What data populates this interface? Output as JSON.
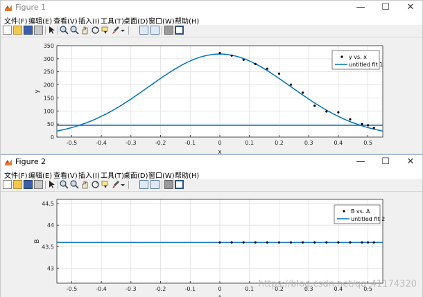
{
  "colors": {
    "fit_line": "#0072bd",
    "hline": "#0072bd",
    "points": "#000000",
    "grid": "#dfdfdf"
  },
  "figure1": {
    "title": "Figure 1",
    "menu": [
      "文件(F)",
      "编辑(E)",
      "查看(V)",
      "插入(I)",
      "工具(T)",
      "桌面(D)",
      "窗口(W)",
      "帮助(H)"
    ],
    "toolbar_icons": [
      "new-file-icon",
      "open-folder-icon",
      "save-icon",
      "print-icon",
      "pointer-icon",
      "zoom-in-icon",
      "zoom-out-icon",
      "pan-hand-icon",
      "rotate-3d-icon",
      "data-cursor-icon",
      "brush-icon",
      "brush-dropdown-icon",
      "colorbar-icon",
      "legend-icon",
      "plot-tools-hide-icon",
      "plot-tools-show-icon"
    ],
    "window_controls": {
      "minimize": "—",
      "maximize": "☐",
      "close": "✕"
    },
    "chart_data": {
      "type": "scatter",
      "xlabel": "x",
      "ylabel": "y",
      "xlim": [
        -0.55,
        0.55
      ],
      "ylim": [
        0,
        350
      ],
      "xticks": [
        "-0.5",
        "-0.4",
        "-0.3",
        "-0.2",
        "-0.1",
        "0",
        "0.1",
        "0.2",
        "0.3",
        "0.4",
        "0.5"
      ],
      "xtick_values": [
        -0.5,
        -0.4,
        -0.3,
        -0.2,
        -0.1,
        0,
        0.1,
        0.2,
        0.3,
        0.4,
        0.5
      ],
      "yticks": [
        "0",
        "50",
        "100",
        "150",
        "200",
        "250",
        "300",
        "350"
      ],
      "ytick_values": [
        0,
        50,
        100,
        150,
        200,
        250,
        300,
        350
      ],
      "grid": true,
      "legend_position": "top-right",
      "series": [
        {
          "name": "y vs. x",
          "kind": "points",
          "x": [
            0,
            0.04,
            0.08,
            0.12,
            0.16,
            0.2,
            0.24,
            0.28,
            0.32,
            0.36,
            0.4,
            0.44,
            0.48,
            0.5,
            0.52
          ],
          "y": [
            322,
            312,
            296,
            280,
            262,
            243,
            201,
            170,
            120,
            98,
            95,
            68,
            50,
            45,
            35
          ]
        },
        {
          "name": "untitled fit 1",
          "kind": "gaussian-curve",
          "amplitude": 318,
          "mean": 0,
          "sigma": 0.24
        }
      ],
      "hline": 45
    }
  },
  "figure2": {
    "title": "Figure 2",
    "menu": [
      "文件(F)",
      "编辑(E)",
      "查看(V)",
      "插入(I)",
      "工具(T)",
      "桌面(D)",
      "窗口(W)",
      "帮助(H)"
    ],
    "toolbar_icons": [
      "new-file-icon",
      "open-folder-icon",
      "save-icon",
      "print-icon",
      "pointer-icon",
      "zoom-in-icon",
      "zoom-out-icon",
      "pan-hand-icon",
      "rotate-3d-icon",
      "data-cursor-icon",
      "brush-icon",
      "brush-dropdown-icon",
      "colorbar-icon",
      "legend-icon",
      "plot-tools-hide-icon",
      "plot-tools-show-icon"
    ],
    "window_controls": {
      "minimize": "—",
      "maximize": "☐",
      "close": "✕"
    },
    "chart_data": {
      "type": "scatter",
      "xlabel": "A",
      "ylabel": "B",
      "xlim": [
        -0.55,
        0.55
      ],
      "ylim": [
        42.65,
        44.6
      ],
      "xticks": [
        "-0.5",
        "-0.4",
        "-0.3",
        "-0.2",
        "-0.1",
        "0",
        "0.1",
        "0.2",
        "0.3",
        "0.4",
        "0.5"
      ],
      "xtick_values": [
        -0.5,
        -0.4,
        -0.3,
        -0.2,
        -0.1,
        0,
        0.1,
        0.2,
        0.3,
        0.4,
        0.5
      ],
      "yticks": [
        "43",
        "43.5",
        "44",
        "44.5"
      ],
      "ytick_values": [
        43,
        43.5,
        44,
        44.5
      ],
      "grid": true,
      "legend_position": "top-right",
      "series": [
        {
          "name": "B vs. A",
          "kind": "points",
          "x": [
            0,
            0.04,
            0.08,
            0.12,
            0.16,
            0.2,
            0.24,
            0.28,
            0.32,
            0.36,
            0.4,
            0.44,
            0.48,
            0.5,
            0.52
          ],
          "y": [
            43.6,
            43.6,
            43.6,
            43.6,
            43.6,
            43.6,
            43.6,
            43.6,
            43.6,
            43.6,
            43.6,
            43.6,
            43.6,
            43.6,
            43.6
          ]
        },
        {
          "name": "untitled fit 2",
          "kind": "constant",
          "value": 43.6
        }
      ]
    }
  },
  "watermark": "https://blog.csdn.net/qq_41174320"
}
